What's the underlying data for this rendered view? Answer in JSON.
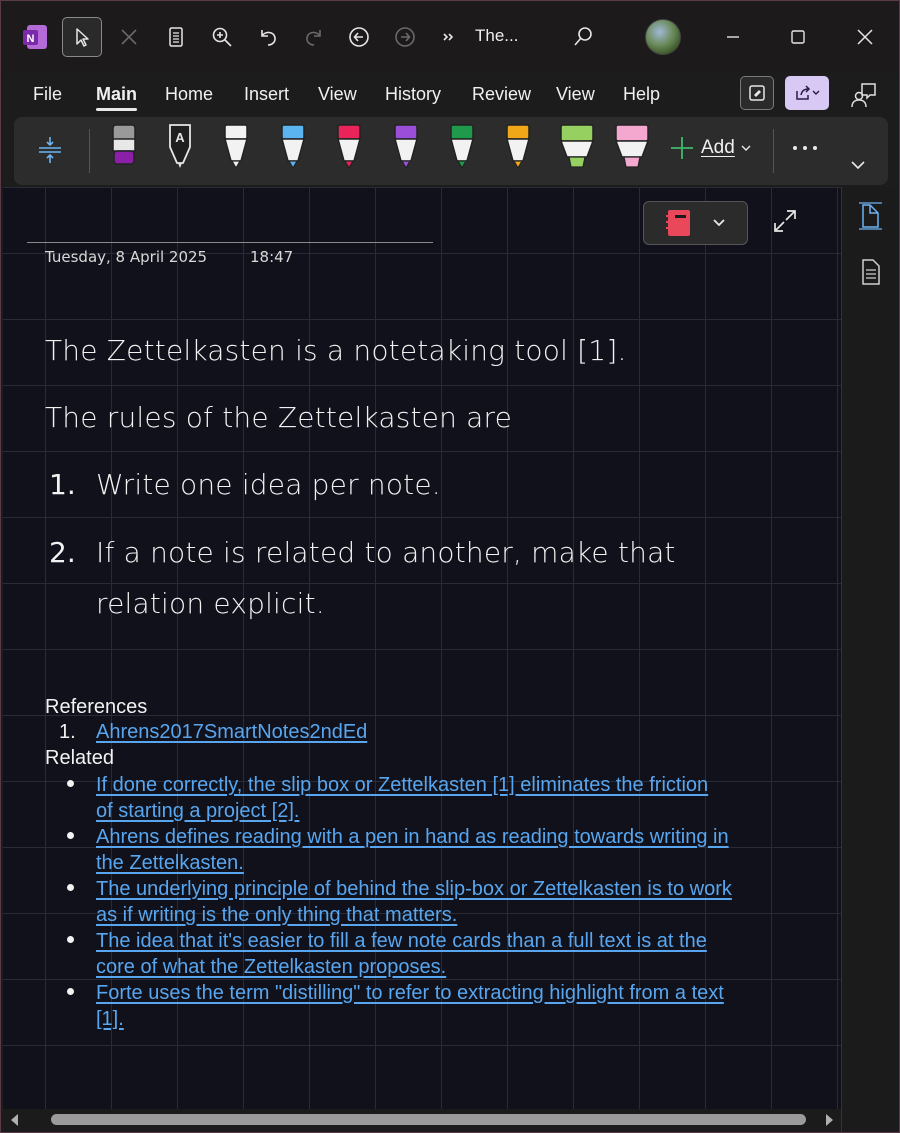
{
  "titlebar": {
    "title": "The...",
    "icons": [
      "onenote-logo-icon",
      "select-pointer-icon",
      "close-x-icon",
      "page-view-icon",
      "zoom-icon",
      "undo-icon",
      "redo-icon",
      "back-icon",
      "forward-icon",
      "overflow-chevrons-icon",
      "search-icon",
      "avatar",
      "minimize-icon",
      "maximize-icon",
      "close-icon"
    ]
  },
  "menu": {
    "items": [
      "File",
      "Main",
      "Home",
      "Insert",
      "View",
      "History",
      "Review",
      "View",
      "Help"
    ],
    "active": "Main"
  },
  "ribbon": {
    "add_label": "Add",
    "pens": [
      {
        "name": "eraser",
        "color": "#8b1fa8"
      },
      {
        "name": "ink-to-text-pen",
        "color": "#e0e0e0"
      },
      {
        "name": "white-pen",
        "color": "#f2f2f2"
      },
      {
        "name": "blue-pen",
        "color": "#5bb4f0"
      },
      {
        "name": "red-pen",
        "color": "#e8245a"
      },
      {
        "name": "purple-pen",
        "color": "#9b4fd8"
      },
      {
        "name": "green-pen",
        "color": "#1e9a4a"
      },
      {
        "name": "yellow-pen",
        "color": "#f0a818"
      },
      {
        "name": "green-highlighter",
        "color": "#96d060"
      },
      {
        "name": "pink-highlighter",
        "color": "#f4a8d0"
      }
    ]
  },
  "page": {
    "date": "Tuesday, 8 April 2025",
    "time": "18:47",
    "line1": "The Zettelkasten is a notetaking tool [1].",
    "line2": "The rules of the Zettelkasten are",
    "rules": [
      {
        "num": "1.",
        "text_a": "Write one idea per note.",
        "text_b": ""
      },
      {
        "num": "2.",
        "text_a": "If a note is related to another, make that",
        "text_b": "relation explicit."
      }
    ],
    "references_heading": "References",
    "references": [
      {
        "num": "1.",
        "text": "Ahrens2017SmartNotes2ndEd"
      }
    ],
    "related_heading": "Related",
    "related": [
      {
        "a": "If done correctly, the slip box or Zettelkasten [1] eliminates the friction",
        "b": "of starting a project [2]."
      },
      {
        "a": "Ahrens defines reading with a pen in hand as reading towards writing in",
        "b": "the Zettelkasten."
      },
      {
        "a": "The underlying principle of behind the slip-box or Zettelkasten is to work",
        "b": "as if writing is the only thing that matters."
      },
      {
        "a": "The idea that it's easier to fill a few note cards than a full text is at the",
        "b": "core of what the Zettelkasten proposes."
      },
      {
        "a": "Forte uses the term \"distilling\" to refer to extracting highlight from a text",
        "b": "[1]."
      }
    ]
  },
  "colors": {
    "link": "#58a6f0",
    "canvas": "#10111a",
    "notebook": "#e8485a"
  }
}
